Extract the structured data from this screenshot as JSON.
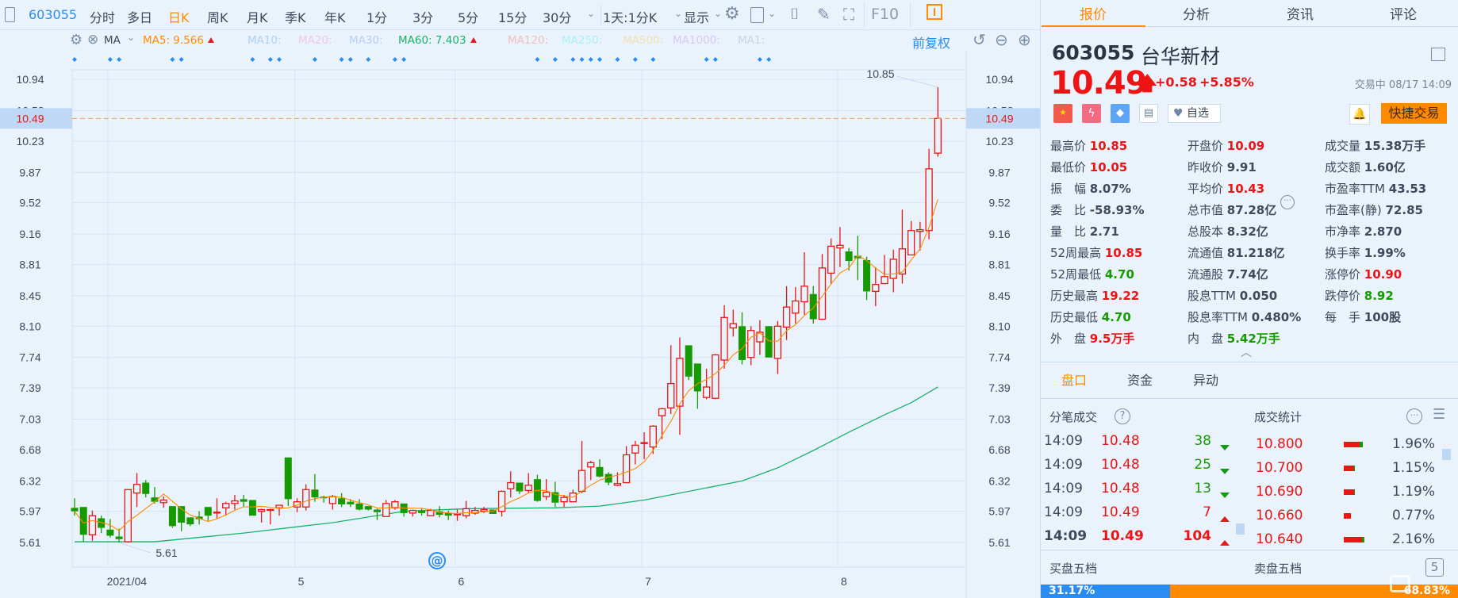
{
  "toolbar": {
    "code": "603055",
    "periods": [
      "分时",
      "多日",
      "日K",
      "周K",
      "月K",
      "季K",
      "年K",
      "1分",
      "3分",
      "5分",
      "15分",
      "30分"
    ],
    "active_period": "日K",
    "interval": "1天:1分K",
    "display": "显示",
    "f10": "F10"
  },
  "ma_row": {
    "ma_label": "MA",
    "items": [
      {
        "label": "MA5: 9.566",
        "color": "#ff8a00",
        "up": true
      },
      {
        "label": "MA10:",
        "color": "#a9d4f5"
      },
      {
        "label": "MA20:",
        "color": "#f0c8e8"
      },
      {
        "label": "MA30:",
        "color": "#b8d0f5"
      },
      {
        "label": "MA60: 7.403",
        "color": "#19b36b",
        "up": true
      },
      {
        "label": "MA120:",
        "color": "#f5c0c0"
      },
      {
        "label": "MA250:",
        "color": "#a8f0f5"
      },
      {
        "label": "MA500:",
        "color": "#f5e0b0"
      },
      {
        "label": "MA1000:",
        "color": "#d6c8f5"
      },
      {
        "label": "MA1:",
        "color": "#c8d4e0"
      }
    ],
    "adjust": "前复权"
  },
  "chart_data": {
    "type": "candlestick",
    "ohlc": [
      [
        6.01,
        6.12,
        5.92,
        5.97
      ],
      [
        6.02,
        6.02,
        5.62,
        5.7
      ],
      [
        5.7,
        5.98,
        5.63,
        5.92
      ],
      [
        5.89,
        5.92,
        5.72,
        5.78
      ],
      [
        5.76,
        5.88,
        5.67,
        5.69
      ],
      [
        5.68,
        5.77,
        5.61,
        5.65
      ],
      [
        5.62,
        6.22,
        5.61,
        6.22
      ],
      [
        6.18,
        6.41,
        6.02,
        6.28
      ],
      [
        6.3,
        6.33,
        6.13,
        6.17
      ],
      [
        6.13,
        6.25,
        6.06,
        6.08
      ],
      [
        6.07,
        6.14,
        6.01,
        6.1
      ],
      [
        6.03,
        6.03,
        5.78,
        5.8
      ],
      [
        6.03,
        6.03,
        5.74,
        5.84
      ],
      [
        5.9,
        5.9,
        5.8,
        5.82
      ],
      [
        5.91,
        5.97,
        5.82,
        5.88
      ],
      [
        6.02,
        6.02,
        5.86,
        5.92
      ],
      [
        5.95,
        6.12,
        5.89,
        5.96
      ],
      [
        6.01,
        6.08,
        5.92,
        6.06
      ],
      [
        6.06,
        6.16,
        5.99,
        6.09
      ],
      [
        6.11,
        6.16,
        6.02,
        6.08
      ],
      [
        6.1,
        6.1,
        5.92,
        5.92
      ],
      [
        5.97,
        6.0,
        5.84,
        5.99
      ],
      [
        5.985,
        6.0,
        5.82,
        5.99
      ],
      [
        6.01,
        6.04,
        5.92,
        6.04
      ],
      [
        6.59,
        6.59,
        6.03,
        6.11
      ],
      [
        6.02,
        6.12,
        5.96,
        6.08
      ],
      [
        6.02,
        6.28,
        5.98,
        6.22
      ],
      [
        6.22,
        6.4,
        6.08,
        6.13
      ],
      [
        6.14,
        6.15,
        6.07,
        6.12
      ],
      [
        6.06,
        6.16,
        5.99,
        6.14
      ],
      [
        6.12,
        6.18,
        6.02,
        6.05
      ],
      [
        6.08,
        6.11,
        6.02,
        6.05
      ],
      [
        6.06,
        6.11,
        5.98,
        5.99
      ],
      [
        6.03,
        6.03,
        5.98,
        5.99
      ],
      [
        5.99,
        6.0,
        5.87,
        5.96
      ],
      [
        5.91,
        6.1,
        5.91,
        6.06
      ],
      [
        6.01,
        6.1,
        5.99,
        6.08
      ],
      [
        6.06,
        6.06,
        5.91,
        5.95
      ],
      [
        5.95,
        5.99,
        5.91,
        5.98
      ],
      [
        5.98,
        6.01,
        5.92,
        5.95
      ],
      [
        5.92,
        6.0,
        5.92,
        5.98
      ],
      [
        5.97,
        6.03,
        5.9,
        5.93
      ],
      [
        5.95,
        5.98,
        5.87,
        5.92
      ],
      [
        5.93,
        5.99,
        5.86,
        5.94
      ],
      [
        5.92,
        6.09,
        5.89,
        6.0
      ],
      [
        5.95,
        6.02,
        5.93,
        5.98
      ],
      [
        5.97,
        6.02,
        5.95,
        5.99
      ],
      [
        5.99,
        5.99,
        5.94,
        5.94
      ],
      [
        5.97,
        6.21,
        5.91,
        6.2
      ],
      [
        6.23,
        6.43,
        6.13,
        6.3
      ],
      [
        6.3,
        6.3,
        6.17,
        6.2
      ],
      [
        6.21,
        6.41,
        6.18,
        6.27
      ],
      [
        6.34,
        6.39,
        6.08,
        6.09
      ],
      [
        6.14,
        6.34,
        6.1,
        6.19
      ],
      [
        6.19,
        6.31,
        6.02,
        6.07
      ],
      [
        6.08,
        6.16,
        6.02,
        6.13
      ],
      [
        6.08,
        6.22,
        6.08,
        6.18
      ],
      [
        6.2,
        6.78,
        6.18,
        6.44
      ],
      [
        6.48,
        6.55,
        6.33,
        6.53
      ],
      [
        6.48,
        6.57,
        6.36,
        6.37
      ],
      [
        6.4,
        6.42,
        6.27,
        6.3
      ],
      [
        6.27,
        6.42,
        6.26,
        6.29
      ],
      [
        6.3,
        6.72,
        6.3,
        6.62
      ],
      [
        6.64,
        6.78,
        6.51,
        6.73
      ],
      [
        6.75,
        6.88,
        6.57,
        6.76
      ],
      [
        6.71,
        6.96,
        6.63,
        6.95
      ],
      [
        7.07,
        7.16,
        6.8,
        7.15
      ],
      [
        7.16,
        7.88,
        7.09,
        7.44
      ],
      [
        7.18,
        7.97,
        6.85,
        7.73
      ],
      [
        7.88,
        7.88,
        7.48,
        7.52
      ],
      [
        7.67,
        7.67,
        7.15,
        7.35
      ],
      [
        7.28,
        7.61,
        7.26,
        7.4
      ],
      [
        7.27,
        7.78,
        7.26,
        7.77
      ],
      [
        7.71,
        8.34,
        7.61,
        8.2
      ],
      [
        8.08,
        8.29,
        7.98,
        8.13
      ],
      [
        8.1,
        8.26,
        7.66,
        7.71
      ],
      [
        7.74,
        8.1,
        7.65,
        8.05
      ],
      [
        7.92,
        8.17,
        7.77,
        8.03
      ],
      [
        8.1,
        8.1,
        7.74,
        7.74
      ],
      [
        7.73,
        8.16,
        7.55,
        8.1
      ],
      [
        8.09,
        8.56,
        7.94,
        8.32
      ],
      [
        8.25,
        8.55,
        8.13,
        8.39
      ],
      [
        8.38,
        8.95,
        8.23,
        8.56
      ],
      [
        8.47,
        8.56,
        8.13,
        8.18
      ],
      [
        8.18,
        8.93,
        8.18,
        8.77
      ],
      [
        8.71,
        9.11,
        8.59,
        9.02
      ],
      [
        9.0,
        9.24,
        8.78,
        9.03
      ],
      [
        8.96,
        9.0,
        8.74,
        8.85
      ],
      [
        8.91,
        9.14,
        8.63,
        8.88
      ],
      [
        8.86,
        8.9,
        8.4,
        8.5
      ],
      [
        8.5,
        8.78,
        8.33,
        8.58
      ],
      [
        8.59,
        8.92,
        8.59,
        8.67
      ],
      [
        8.65,
        8.98,
        8.49,
        8.87
      ],
      [
        8.7,
        9.44,
        8.59,
        8.99
      ],
      [
        8.92,
        9.31,
        8.92,
        9.2
      ],
      [
        9.19,
        9.3,
        8.97,
        9.21
      ],
      [
        9.2,
        10.14,
        9.1,
        9.91
      ],
      [
        10.09,
        10.85,
        10.05,
        10.49
      ]
    ],
    "ma60_points": [
      [
        0,
        5.62
      ],
      [
        9,
        5.62
      ],
      [
        19,
        5.72
      ],
      [
        29,
        5.84
      ],
      [
        37,
        5.97
      ],
      [
        44,
        6.0
      ],
      [
        54,
        6.01
      ],
      [
        59,
        6.03
      ],
      [
        64,
        6.1
      ],
      [
        69,
        6.2
      ],
      [
        75,
        6.32
      ],
      [
        79,
        6.47
      ],
      [
        83,
        6.67
      ],
      [
        87,
        6.88
      ],
      [
        91,
        7.08
      ],
      [
        94,
        7.22
      ],
      [
        97,
        7.4
      ]
    ],
    "y_ticks": [
      "10.94",
      "10.58",
      "10.23",
      "9.87",
      "9.52",
      "9.16",
      "8.81",
      "8.45",
      "8.10",
      "7.74",
      "7.39",
      "7.03",
      "6.68",
      "6.32",
      "5.97",
      "5.61"
    ],
    "ylim": [
      5.61,
      10.94
    ],
    "x_ticks": [
      {
        "index": 4,
        "label": "2021/04"
      },
      {
        "index": 25,
        "label": "5"
      },
      {
        "index": 43,
        "label": "6"
      },
      {
        "index": 64,
        "label": "7"
      },
      {
        "index": 86,
        "label": "8"
      }
    ],
    "current_price": "10.49",
    "high_annotation": "10.85",
    "low_annotation": "5.61",
    "event_marker_indices": [
      0,
      4,
      5,
      11,
      12,
      20,
      22,
      23,
      27,
      30,
      31,
      33,
      36,
      37,
      52,
      54,
      56,
      57,
      58,
      59,
      61,
      63,
      65,
      71,
      72,
      77,
      78
    ],
    "colors": {
      "up": "#ee1414",
      "down": "#159a00",
      "ma5": "#ff8a00",
      "ma60": "#19b36b",
      "marker": "#2a8cf0"
    }
  },
  "panel": {
    "tabs": [
      "报价",
      "分析",
      "资讯",
      "评论"
    ],
    "active_tab": "报价",
    "code": "603055",
    "name": "台华新材",
    "price": "10.49",
    "change": "+0.58",
    "change_pct": "+5.85%",
    "status": "交易中 08/17 14:09",
    "watch_label": "自选",
    "quick_trade": "快捷交易",
    "stats": [
      [
        {
          "k": "最高价",
          "v": "10.85",
          "c": "red"
        },
        {
          "k": "开盘价",
          "v": "10.09",
          "c": "red"
        },
        {
          "k": "成交量",
          "v": "15.38万手",
          "c": ""
        }
      ],
      [
        {
          "k": "最低价",
          "v": "10.05",
          "c": "red"
        },
        {
          "k": "昨收价",
          "v": "9.91",
          "c": ""
        },
        {
          "k": "成交额",
          "v": "1.60亿",
          "c": ""
        }
      ],
      [
        {
          "k": "振　幅",
          "v": "8.07%",
          "c": ""
        },
        {
          "k": "平均价",
          "v": "10.43",
          "c": "red"
        },
        {
          "k": "市盈率TTM",
          "v": "43.53",
          "c": ""
        }
      ],
      [
        {
          "k": "委　比",
          "v": "-58.93%",
          "c": ""
        },
        {
          "k": "总市值",
          "v": "87.28亿",
          "c": ""
        },
        {
          "k": "市盈率(静)",
          "v": "72.85",
          "c": ""
        }
      ],
      [
        {
          "k": "量　比",
          "v": "2.71",
          "c": ""
        },
        {
          "k": "总股本",
          "v": "8.32亿",
          "c": ""
        },
        {
          "k": "市净率",
          "v": "2.870",
          "c": ""
        }
      ],
      [
        {
          "k": "52周最高",
          "v": "10.85",
          "c": "red"
        },
        {
          "k": "流通值",
          "v": "81.218亿",
          "c": ""
        },
        {
          "k": "换手率",
          "v": "1.99%",
          "c": ""
        }
      ],
      [
        {
          "k": "52周最低",
          "v": "4.70",
          "c": "green"
        },
        {
          "k": "流通股",
          "v": "7.74亿",
          "c": ""
        },
        {
          "k": "涨停价",
          "v": "10.90",
          "c": "red"
        }
      ],
      [
        {
          "k": "历史最高",
          "v": "19.22",
          "c": "red"
        },
        {
          "k": "股息TTM",
          "v": "0.050",
          "c": ""
        },
        {
          "k": "跌停价",
          "v": "8.92",
          "c": "green"
        }
      ],
      [
        {
          "k": "历史最低",
          "v": "4.70",
          "c": "green"
        },
        {
          "k": "股息率TTM",
          "v": "0.480%",
          "c": ""
        },
        {
          "k": "每　手",
          "v": "100股",
          "c": ""
        }
      ],
      [
        {
          "k": "外　盘",
          "v": "9.5万手",
          "c": "red"
        },
        {
          "k": "内　盘",
          "v": "5.42万手",
          "c": "green"
        }
      ]
    ],
    "sub_tabs": [
      "盘口",
      "资金",
      "异动"
    ],
    "active_sub_tab": "盘口",
    "ticks_title": "分笔成交",
    "ticks": [
      {
        "time": "14:09",
        "price": "10.48",
        "vol": "38",
        "dir": "down"
      },
      {
        "time": "14:09",
        "price": "10.48",
        "vol": "25",
        "dir": "down"
      },
      {
        "time": "14:09",
        "price": "10.48",
        "vol": "13",
        "dir": "down"
      },
      {
        "time": "14:09",
        "price": "10.49",
        "vol": "7",
        "dir": "up"
      },
      {
        "time": "14:09",
        "price": "10.49",
        "vol": "104",
        "dir": "up"
      }
    ],
    "stats_title": "成交统计",
    "volume_stats": [
      {
        "price": "10.800",
        "pct": "1.96%",
        "buy": 0.84,
        "value": 1.96
      },
      {
        "price": "10.700",
        "pct": "1.15%",
        "buy": 0.9,
        "value": 1.15
      },
      {
        "price": "10.690",
        "pct": "1.19%",
        "buy": 0.95,
        "value": 1.19
      },
      {
        "price": "10.660",
        "pct": "0.77%",
        "buy": 1.0,
        "value": 0.77
      },
      {
        "price": "10.640",
        "pct": "2.16%",
        "buy": 0.88,
        "value": 2.16
      }
    ],
    "bid_title": "买盘五档",
    "ask_title": "卖盘五档",
    "levels_button": "5",
    "bid_pct": "31.17%",
    "ask_pct": "68.83%",
    "bid_ratio": 31.17
  }
}
